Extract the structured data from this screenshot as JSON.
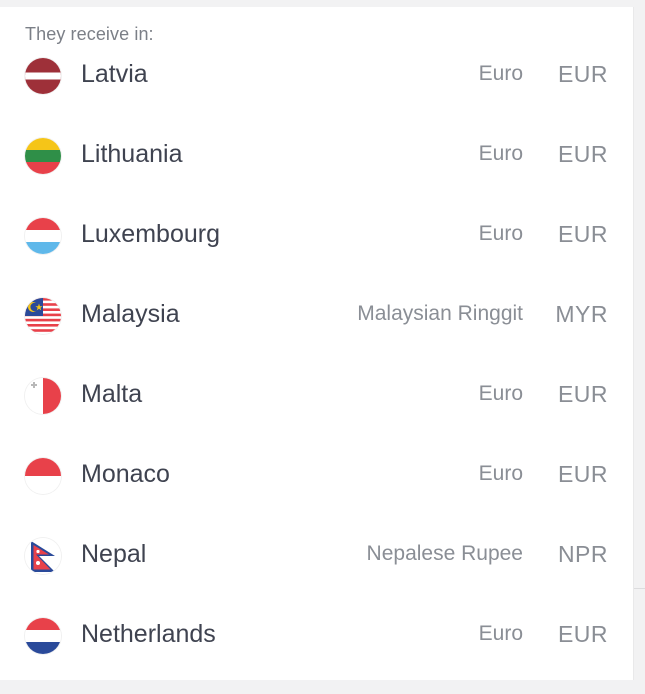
{
  "header": {
    "label": "They receive in:"
  },
  "countries": [
    {
      "name": "Latvia",
      "currency_name": "Euro",
      "currency_code": "EUR",
      "flag_icon": "latvia-flag-icon"
    },
    {
      "name": "Lithuania",
      "currency_name": "Euro",
      "currency_code": "EUR",
      "flag_icon": "lithuania-flag-icon"
    },
    {
      "name": "Luxembourg",
      "currency_name": "Euro",
      "currency_code": "EUR",
      "flag_icon": "luxembourg-flag-icon"
    },
    {
      "name": "Malaysia",
      "currency_name": "Malaysian Ringgit",
      "currency_code": "MYR",
      "flag_icon": "malaysia-flag-icon"
    },
    {
      "name": "Malta",
      "currency_name": "Euro",
      "currency_code": "EUR",
      "flag_icon": "malta-flag-icon"
    },
    {
      "name": "Monaco",
      "currency_name": "Euro",
      "currency_code": "EUR",
      "flag_icon": "monaco-flag-icon"
    },
    {
      "name": "Nepal",
      "currency_name": "Nepalese Rupee",
      "currency_code": "NPR",
      "flag_icon": "nepal-flag-icon"
    },
    {
      "name": "Netherlands",
      "currency_name": "Euro",
      "currency_code": "EUR",
      "flag_icon": "netherlands-flag-icon"
    }
  ],
  "colors": {
    "text_primary": "#3f4350",
    "text_secondary": "#8a8e95",
    "latvia_red": "#9e3039",
    "red": "#e8414a",
    "blue": "#2a4a9a",
    "yellow": "#f5c518",
    "green": "#2f8f48"
  }
}
